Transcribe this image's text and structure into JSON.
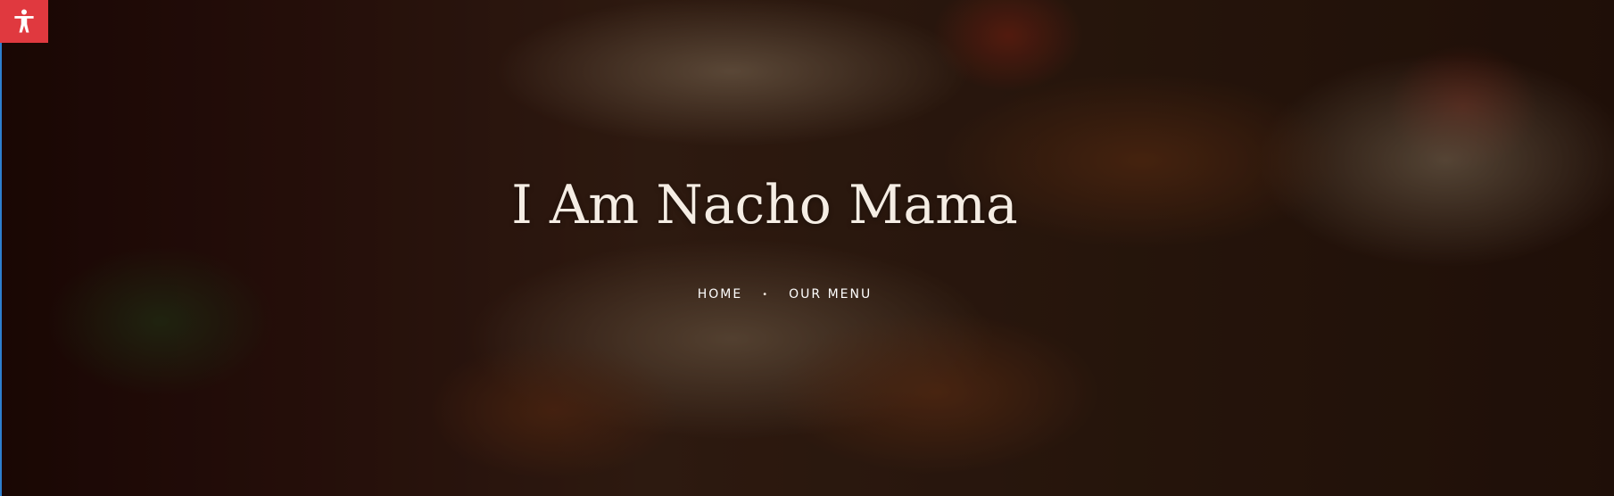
{
  "hero": {
    "title": "I Am Nacho Mama"
  },
  "breadcrumb": {
    "home": "HOME",
    "separator": "•",
    "current": "OUR MENU"
  },
  "accessibility": {
    "icon": "accessibility-person-icon",
    "color": "#e0393f"
  }
}
